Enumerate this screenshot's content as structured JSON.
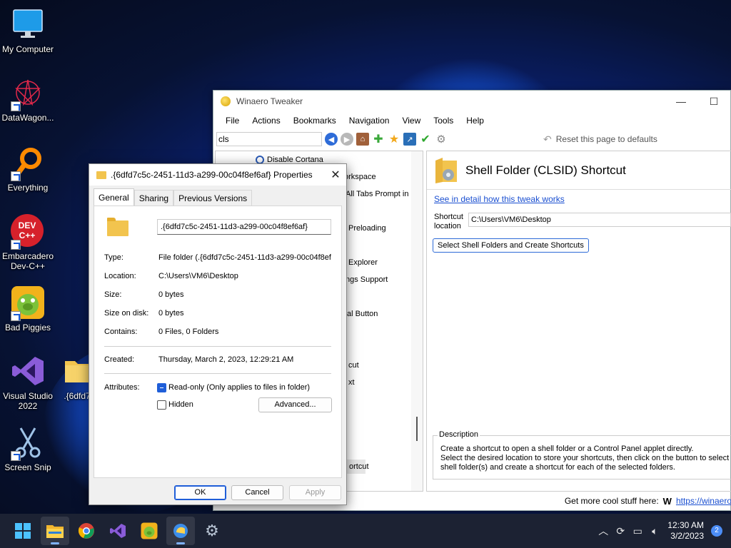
{
  "desktop": {
    "icons": [
      {
        "label": "My Computer",
        "icon": "monitor-icon"
      },
      {
        "label": "DataWagon...",
        "icon": "datawagon-icon"
      },
      {
        "label": "Everything",
        "icon": "everything-search-icon"
      },
      {
        "label": "Embarcadero Dev-C++",
        "icon": "devcpp-icon",
        "badge": "DEV C++"
      },
      {
        "label": "Bad Piggies",
        "icon": "bad-piggies-icon"
      },
      {
        "label": "Visual Studio 2022",
        "icon": "visual-studio-icon"
      },
      {
        "label": ".{6dfd7c",
        "icon": "folder-icon"
      },
      {
        "label": "Screen Snip",
        "icon": "scissors-icon"
      }
    ]
  },
  "tweaker": {
    "title": "Winaero Tweaker",
    "menu": [
      "File",
      "Actions",
      "Bookmarks",
      "Navigation",
      "View",
      "Tools",
      "Help"
    ],
    "search_value": "cls",
    "reset_label": "Reset this page to defaults",
    "tree_items": [
      "Disable Cortana",
      "orkspace",
      "All Tabs Prompt in E",
      "Preloading",
      "Explorer",
      "ngs Support",
      "al Button",
      "cut",
      "xt",
      "ortcut"
    ],
    "panel_title": "Shell Folder (CLSID) Shortcut",
    "detail_link": "See in detail how this tweak works",
    "shortcut_location_label": "Shortcut location",
    "shortcut_location_value": "C:\\Users\\VM6\\Desktop",
    "select_button": "Select Shell Folders and Create Shortcuts",
    "description_caption": "Description",
    "description_lines": [
      "Create a shortcut to open a shell folder or a Control Panel applet directly.",
      "Select the desired location to store your shortcuts, then click on the button to select th",
      "shell folder(s) and create a shortcut for each of the selected folders."
    ],
    "status_text": "Get more cool stuff here:",
    "status_link": "https://winaero"
  },
  "dialog": {
    "title": ".{6dfd7c5c-2451-11d3-a299-00c04f8ef6af} Properties",
    "tabs": [
      "General",
      "Sharing",
      "Previous Versions"
    ],
    "name_value": ".{6dfd7c5c-2451-11d3-a299-00c04f8ef6af}",
    "rows": {
      "type": {
        "label": "Type:",
        "value": "File folder (.{6dfd7c5c-2451-11d3-a299-00c04f8ef"
      },
      "location": {
        "label": "Location:",
        "value": "C:\\Users\\VM6\\Desktop"
      },
      "size": {
        "label": "Size:",
        "value": "0 bytes"
      },
      "size_on_disk": {
        "label": "Size on disk:",
        "value": "0 bytes"
      },
      "contains": {
        "label": "Contains:",
        "value": "0 Files, 0 Folders"
      },
      "created": {
        "label": "Created:",
        "value": "Thursday, March 2, 2023, 12:29:21 AM"
      }
    },
    "attributes_label": "Attributes:",
    "readonly_label": "Read-only (Only applies to files in folder)",
    "hidden_label": "Hidden",
    "advanced_button": "Advanced...",
    "ok": "OK",
    "cancel": "Cancel",
    "apply": "Apply"
  },
  "taskbar": {
    "apps": [
      "start-icon",
      "file-explorer-icon",
      "chrome-icon",
      "visual-studio-icon",
      "bad-piggies-icon",
      "winaero-tweaker-icon",
      "settings-icon"
    ],
    "time": "12:30 AM",
    "date": "3/2/2023",
    "notification_count": "2"
  },
  "colors": {
    "accent": "#1f5ed8",
    "taskbar": "#1c2233",
    "link": "#1a4fd1"
  }
}
